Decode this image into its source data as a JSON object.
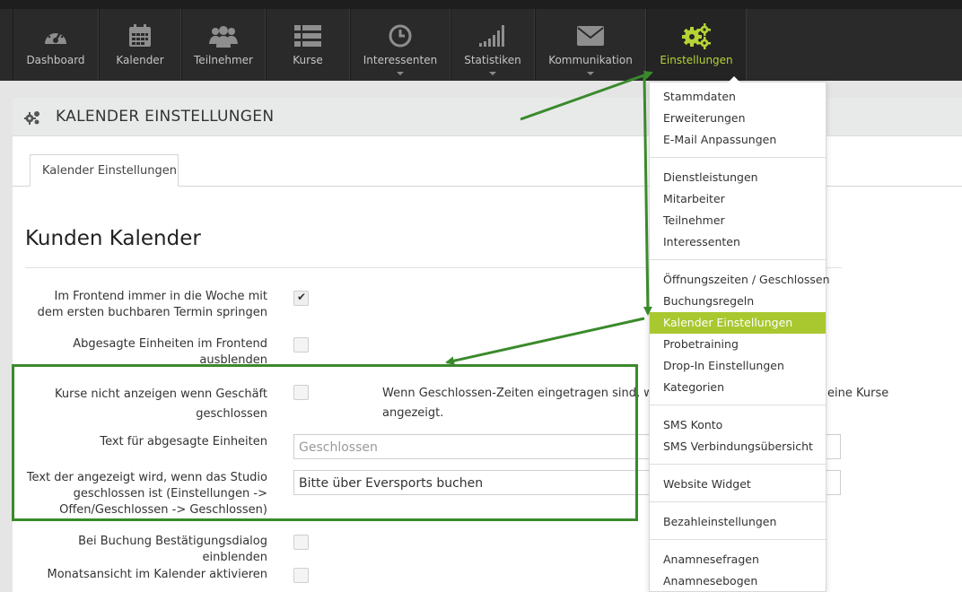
{
  "nav": {
    "items": [
      {
        "label": "Dashboard",
        "icon": "dashboard-icon"
      },
      {
        "label": "Kalender",
        "icon": "calendar-icon"
      },
      {
        "label": "Teilnehmer",
        "icon": "users-icon"
      },
      {
        "label": "Kurse",
        "icon": "list-icon"
      },
      {
        "label": "Interessenten",
        "icon": "clock-icon"
      },
      {
        "label": "Statistiken",
        "icon": "signal-bars-icon"
      },
      {
        "label": "Kommunikation",
        "icon": "envelope-icon"
      },
      {
        "label": "Einstellungen",
        "icon": "gears-icon"
      }
    ],
    "accent_color": "#b5d334"
  },
  "panel": {
    "title": "KALENDER EINSTELLUNGEN",
    "tab": "Kalender Einstellungen",
    "section_title": "Kunden Kalender"
  },
  "settings": {
    "jump_first_week": {
      "label": "Im Frontend immer in die Woche mit dem ersten buchbaren Termin springen",
      "checked": true
    },
    "hide_cancelled": {
      "label": "Abgesagte Einheiten im Frontend ausblenden",
      "checked": false
    },
    "hide_closed": {
      "label": "Kurse nicht anzeigen wenn Geschäft geschlossen",
      "checked": false,
      "help": "Wenn Geschlossen-Zeiten eingetragen sind, werd",
      "help_tail": "eine Kurse",
      "help_line2": "angezeigt."
    },
    "cancelled_text": {
      "label": "Text für abgesagte Einheiten",
      "placeholder": "Geschlossen"
    },
    "closed_text": {
      "label": "Text der angezeigt wird, wenn das Studio geschlossen ist (Einstellungen -> Offen/Geschlossen -> Geschlossen)",
      "value": "Bitte über Eversports buchen"
    },
    "confirm_dialog": {
      "label": "Bei Buchung Bestätigungsdialog einblenden",
      "checked": false
    },
    "month_view": {
      "label": "Monatsansicht im Kalender aktivieren",
      "checked": false
    }
  },
  "menu": {
    "group1": [
      "Stammdaten",
      "Erweiterungen",
      "E-Mail Anpassungen"
    ],
    "group2": [
      "Dienstleistungen",
      "Mitarbeiter",
      "Teilnehmer",
      "Interessenten"
    ],
    "group3": [
      "Öffnungszeiten / Geschlossen",
      "Buchungsregeln",
      "Kalender Einstellungen",
      "Probetraining",
      "Drop-In Einstellungen",
      "Kategorien"
    ],
    "group4": [
      "SMS Konto",
      "SMS Verbindungsübersicht"
    ],
    "group5": [
      "Website Widget"
    ],
    "group6": [
      "Bezahleinstellungen"
    ],
    "group7": [
      "Anamnesefragen",
      "Anamnesebogen"
    ],
    "active_item": "Kalender Einstellungen",
    "active_color": "#a9c82f"
  },
  "annotation_color": "#3a8a2c"
}
